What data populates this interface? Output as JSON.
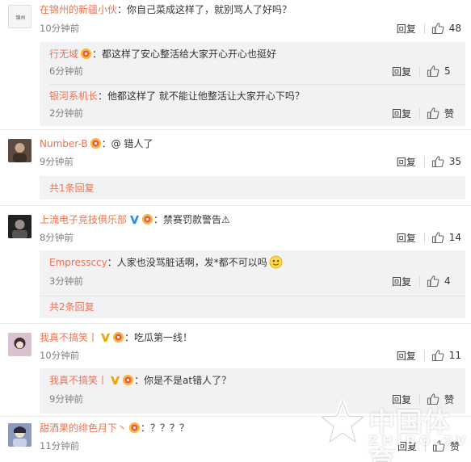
{
  "actions": {
    "reply_label": "回复"
  },
  "comments": [
    {
      "user": "在锦州的新疆小伙",
      "sep": "：",
      "text": "你自己菜成这样了，就别骂人了好吗？",
      "time": "10分钟前",
      "likes": "48",
      "avatar_color": "#e8e8e8",
      "replies": [
        {
          "user": "行无域",
          "sep": "：",
          "text": "都这样了安心整活给大家开心开心也挺好",
          "time": "6分钟前",
          "likes": "5"
        },
        {
          "user": "银河系机长",
          "sep": "：",
          "text": "他都这样了 就不能让他整活让大家开心下吗？",
          "time": "2分钟前",
          "likes": "赞"
        }
      ]
    },
    {
      "user": "Number-B",
      "sep": "：",
      "text": "@ 错人了",
      "time": "9分钟前",
      "likes": "35",
      "avatar_color": "#6a5548",
      "more": "共1条回复"
    },
    {
      "user": "上流电子竞技俱乐部",
      "sep": "：",
      "text": "禁赛罚款警告⚠",
      "time": "8分钟前",
      "likes": "14",
      "avatar_color": "#2b2b2b",
      "replies": [
        {
          "user": "Empressccy",
          "sep": "：",
          "text": "人家也没骂脏话啊，发*都不可以吗",
          "time": "3分钟前",
          "likes": "4"
        }
      ],
      "more": "共2条回复"
    },
    {
      "user": "我真不搞笑丨",
      "sep": "：",
      "text": "吃瓜第一线！",
      "time": "10分钟前",
      "likes": "11",
      "avatar_color": "#c7a7b8",
      "replies": [
        {
          "user": "我真不搞笑丨",
          "sep": "：",
          "text": "你是不是at错人了？",
          "time": "9分钟前",
          "likes": "赞"
        }
      ]
    },
    {
      "user": "甜酒果的绯色月下丶",
      "sep": "：",
      "text": "？？？？",
      "time": "11分钟前",
      "likes": "赞",
      "avatar_color": "#7a88a8"
    }
  ],
  "watermark": {
    "cn": "中国体育",
    "en": "ZHIBO.TV"
  },
  "colors": {
    "username": "#eb7350",
    "reply_bg": "#f2f2f5",
    "time": "#808080"
  }
}
